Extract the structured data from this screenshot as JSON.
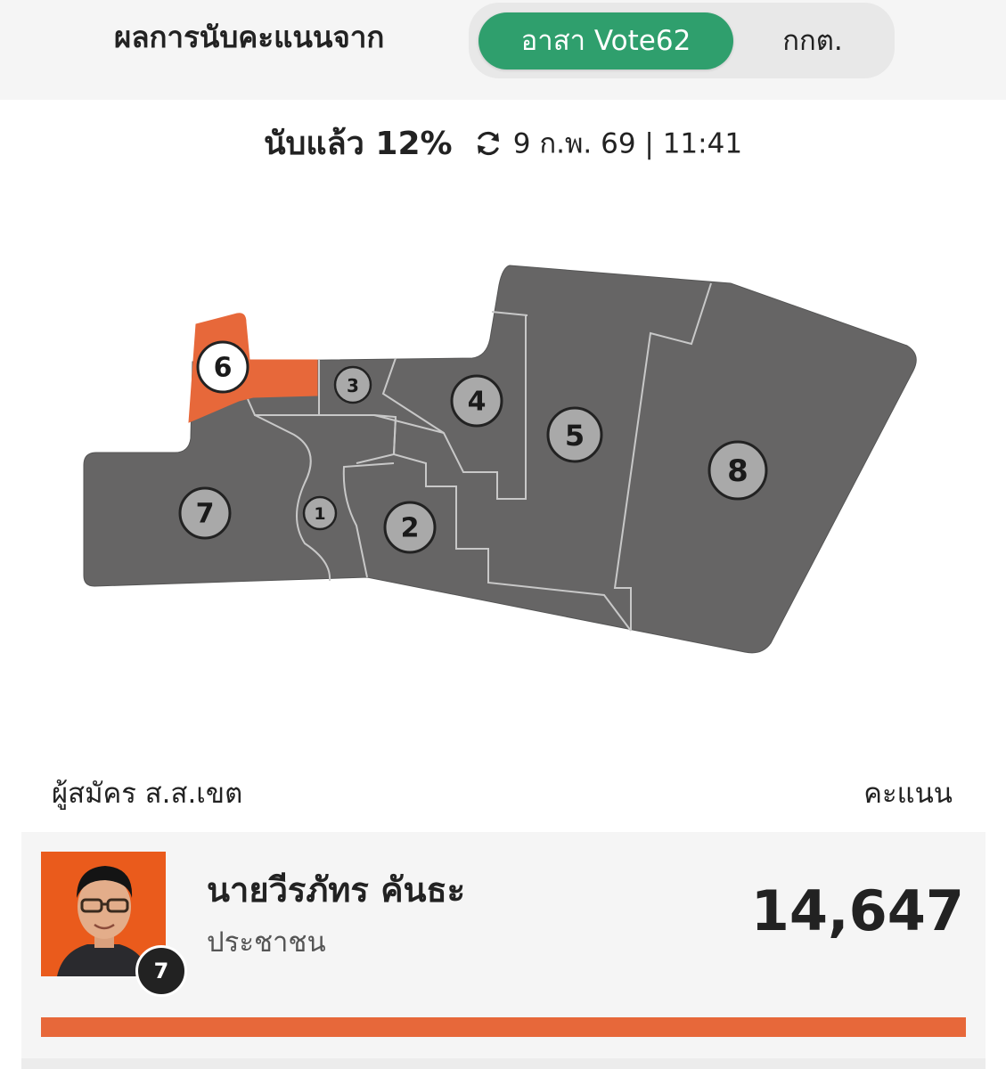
{
  "header": {
    "source_label": "ผลการนับคะแนนจาก",
    "toggle_options": [
      "อาสา Vote62",
      "กกต."
    ],
    "toggle_selected": "อาสา Vote62",
    "accent_color": "#2f9f6d"
  },
  "status": {
    "counted_text": "นับแล้ว 12%",
    "counted_percent": 12,
    "refresh_icon": "refresh-icon",
    "timestamp": "9 ก.พ. 69 | 11:41"
  },
  "map": {
    "highlight_color": "#e7683a",
    "district_color": "#666565",
    "districts": [
      {
        "number": "1",
        "highlighted": false
      },
      {
        "number": "2",
        "highlighted": false
      },
      {
        "number": "3",
        "highlighted": false
      },
      {
        "number": "4",
        "highlighted": false
      },
      {
        "number": "5",
        "highlighted": false
      },
      {
        "number": "6",
        "highlighted": true
      },
      {
        "number": "7",
        "highlighted": false
      },
      {
        "number": "8",
        "highlighted": false
      }
    ]
  },
  "candidates": {
    "header_left": "ผู้สมัคร ส.ส.เขต",
    "header_right": "คะแนน",
    "items": [
      {
        "name": "นายวีรภัทร คันธะ",
        "party": "ประชาชน",
        "number": "7",
        "votes": "14,647",
        "bar_fraction": 1.0,
        "party_color": "#e7683a"
      }
    ]
  }
}
